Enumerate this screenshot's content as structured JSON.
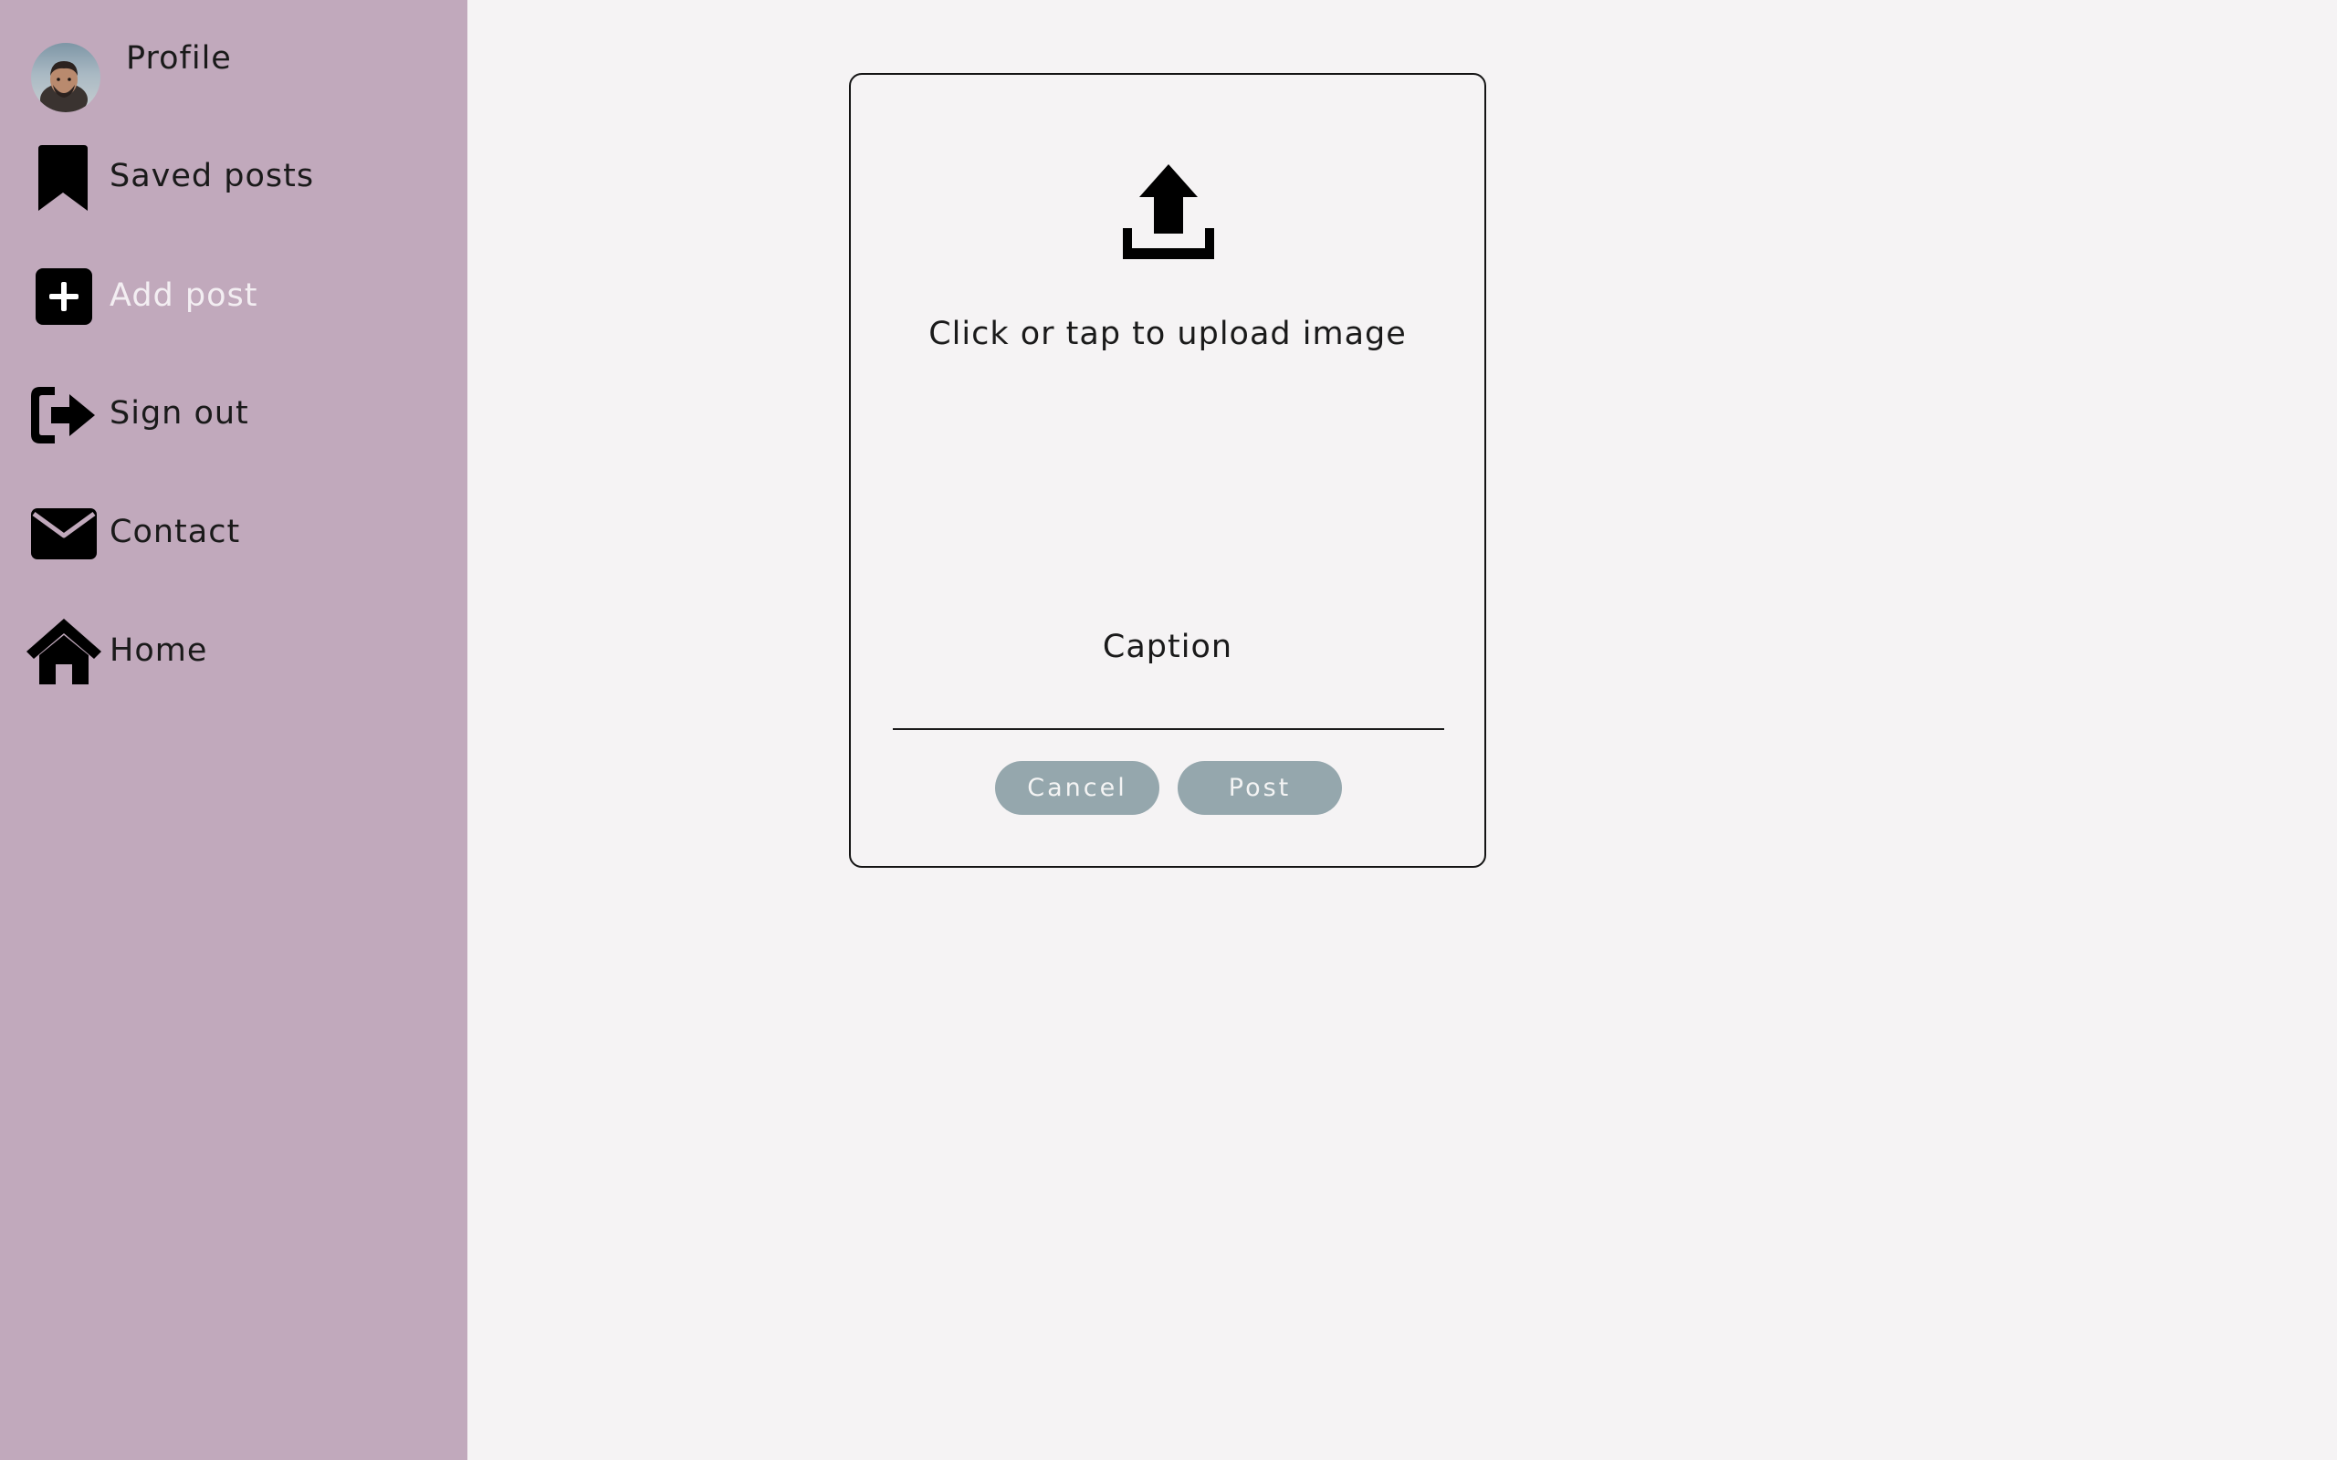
{
  "sidebar": {
    "background": "#c1a9bc",
    "items": [
      {
        "label": "Profile",
        "icon": "avatar"
      },
      {
        "label": "Saved posts",
        "icon": "bookmark-icon"
      },
      {
        "label": "Add post",
        "icon": "plus-square-icon",
        "active": true
      },
      {
        "label": "Sign out",
        "icon": "sign-out-icon"
      },
      {
        "label": "Contact",
        "icon": "envelope-icon"
      },
      {
        "label": "Home",
        "icon": "home-icon"
      }
    ]
  },
  "post_form": {
    "upload_icon": "upload-icon",
    "upload_text": "Click or tap to upload image",
    "caption_label": "Caption",
    "caption_value": "",
    "cancel_label": "Cancel",
    "post_label": "Post",
    "button_color": "#95a7ad"
  }
}
